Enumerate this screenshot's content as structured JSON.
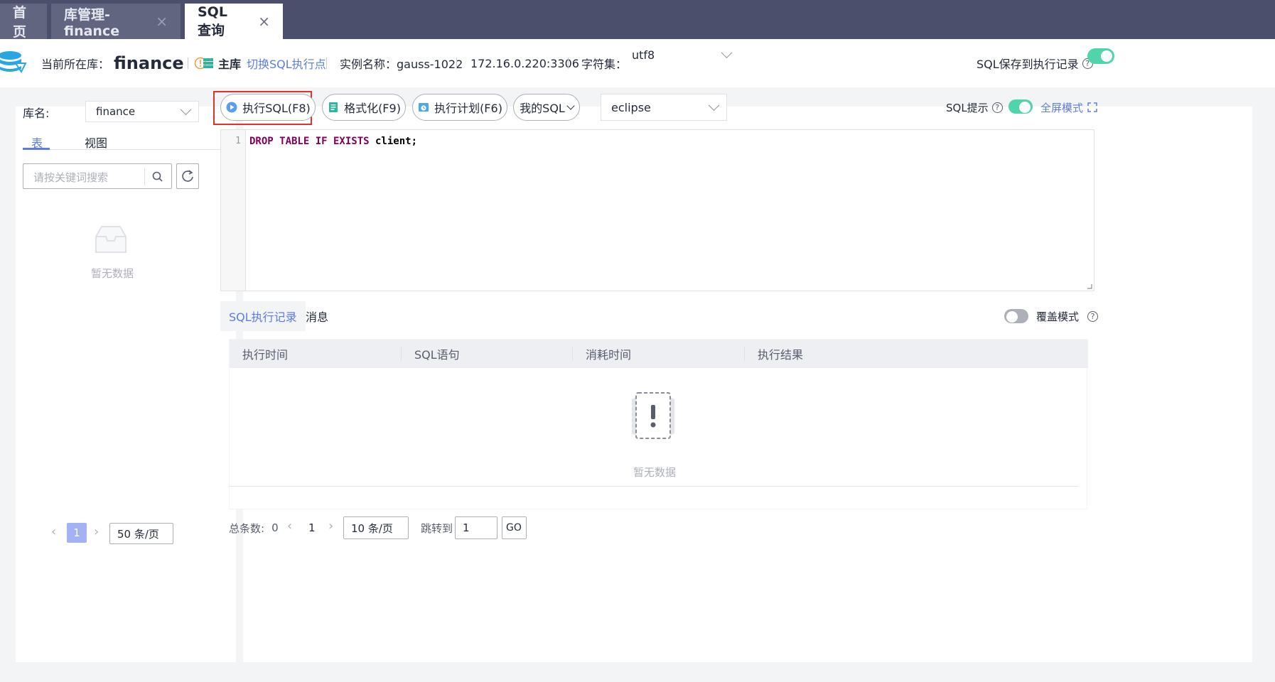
{
  "tabs": [
    {
      "label": "首页"
    },
    {
      "label": "库管理-finance",
      "close": "×"
    },
    {
      "label": "SQL查询",
      "close": "×"
    }
  ],
  "header": {
    "current_db_label": "当前所在库：",
    "current_db": "finance",
    "master_label": "主库",
    "switch_link": "切换SQL执行点",
    "instance_label": "实例名称：gauss-1022",
    "address": "172.16.0.220:3306",
    "charset_label": "字符集：",
    "charset_value": "utf8",
    "save_label": "SQL保存到执行记录",
    "save_enabled": true
  },
  "sidebar": {
    "db_label": "库名:",
    "db_value": "finance",
    "tabs": [
      "表",
      "视图"
    ],
    "search_placeholder": "请按关键词搜索",
    "empty": "暂无数据",
    "page": "1",
    "page_size": "50 条/页"
  },
  "toolbar": {
    "run": "执行SQL(F8)",
    "format": "格式化(F9)",
    "plan": "执行计划(F6)",
    "my_sql": "我的SQL",
    "theme": "eclipse",
    "hint_label": "SQL提示",
    "hint_enabled": true,
    "fullscreen": "全屏模式"
  },
  "editor": {
    "line_number": "1",
    "code_keywords": "DROP TABLE IF EXISTS",
    "code_rest": " client;"
  },
  "results": {
    "tabs": [
      "SQL执行记录",
      "消息"
    ],
    "overwrite_label": "覆盖模式",
    "overwrite_enabled": false,
    "columns": [
      "执行时间",
      "SQL语句",
      "消耗时间",
      "执行结果"
    ],
    "empty": "暂无数据",
    "total_label": "总条数:",
    "total": "0",
    "page": "1",
    "page_size": "10 条/页",
    "jump_label": "跳转到",
    "jump_value": "1",
    "go": "GO"
  },
  "colors": {
    "accent": "#5e7ce0",
    "toggle_on": "#50d4ab",
    "highlight_box": "#e5302d",
    "tabbar": "#4c4f6b"
  }
}
